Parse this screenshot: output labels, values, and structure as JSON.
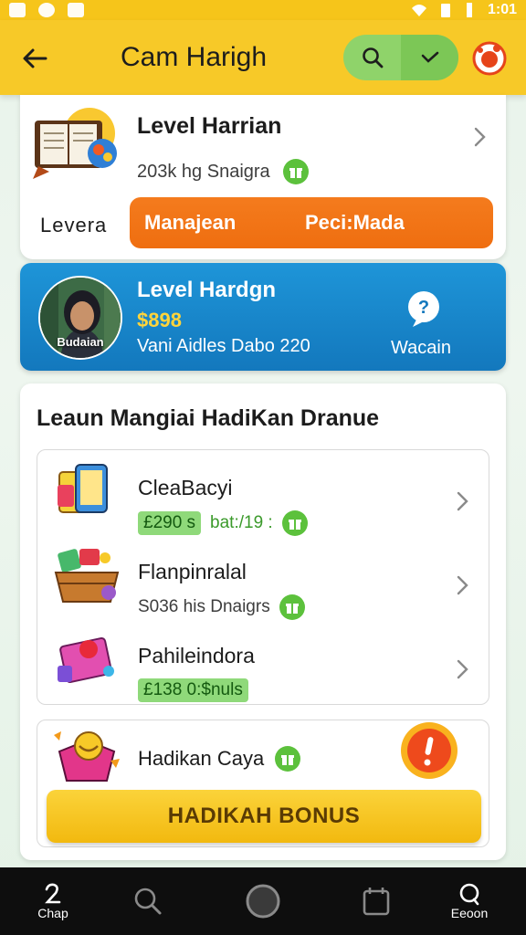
{
  "status_bar": {
    "time": "1:01"
  },
  "header": {
    "title": "Cam Haragh",
    "title_display": "Cam Harigh"
  },
  "card1": {
    "title": "Level Harrian",
    "subtitle": "203k hg Snaigra",
    "label": "Levera",
    "button_left": "Manajean",
    "button_right": "Peci:Mada"
  },
  "blue_card": {
    "title": "Level Hardgn",
    "price": "$898",
    "subtitle": "Vani Aidles Dabo 220",
    "avatar_caption": "Budaian",
    "action_label": "Wacain"
  },
  "section": {
    "title": "Leaun Mangiai HadiKan Dranue",
    "items": [
      {
        "title": "CleaBacyi",
        "tag": "£290 s",
        "meta": "bat:/19 :"
      },
      {
        "title": "Flanpinralal",
        "meta": "S036 his Dnaigrs"
      },
      {
        "title": "Pahileindora",
        "tag": "£138 0:$nuls"
      }
    ],
    "bonus": {
      "title": "Hadikan Caya",
      "button": "HADIKAH BONUS"
    }
  },
  "bottom_nav": {
    "items": [
      {
        "label": "Chap",
        "icon": "home-icon"
      },
      {
        "label": "",
        "icon": "search-icon"
      },
      {
        "label": "",
        "icon": "circle-icon"
      },
      {
        "label": "",
        "icon": "calendar-icon"
      },
      {
        "label": "Eeoon",
        "icon": "profile-icon"
      }
    ]
  },
  "colors": {
    "header": "#f7c928",
    "accent_orange": "#ef6e10",
    "card_blue": "#1e95d8",
    "bonus_yellow": "#f2b90f",
    "green": "#5cc13c"
  }
}
